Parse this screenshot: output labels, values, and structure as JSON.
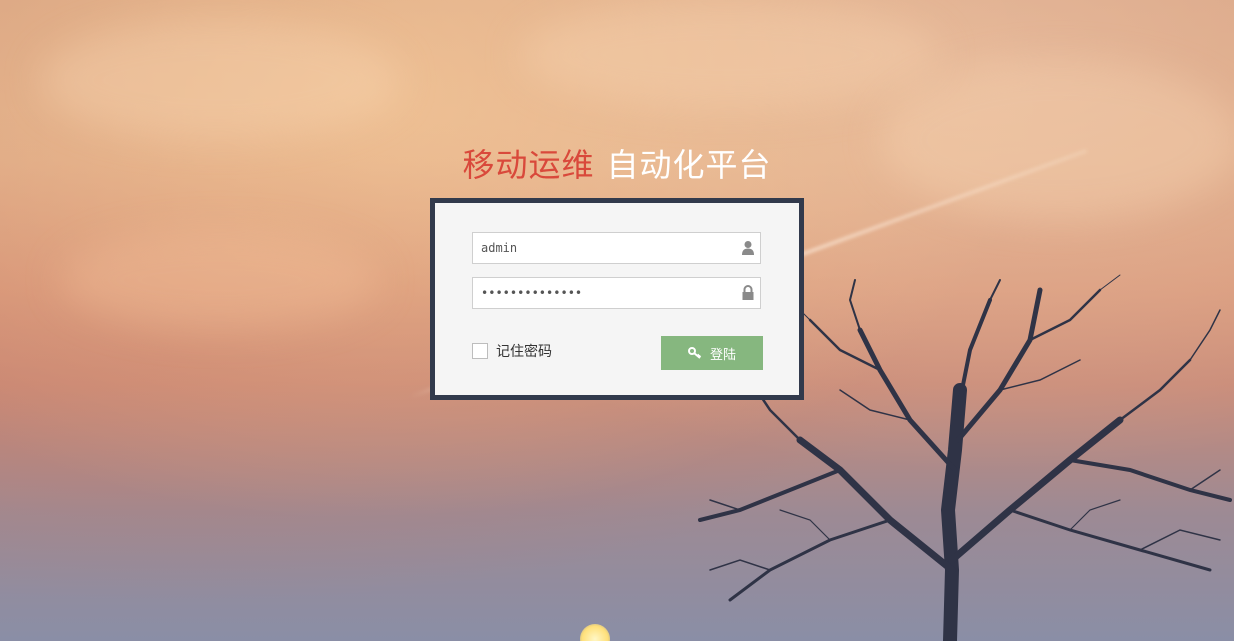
{
  "title": {
    "part1": "移动运维",
    "part2": "自动化平台"
  },
  "login": {
    "username": {
      "value": "admin",
      "icon": "user-icon"
    },
    "password": {
      "value": "••••••••••••••",
      "icon": "lock-icon"
    },
    "remember_label": "记住密码",
    "button_label": "登陆",
    "button_icon": "key-icon"
  },
  "colors": {
    "title_accent": "#d9493b",
    "title_main": "#ffffff",
    "box_border": "#323a4c",
    "box_background": "#f5f5f5",
    "button": "#86b77f"
  }
}
